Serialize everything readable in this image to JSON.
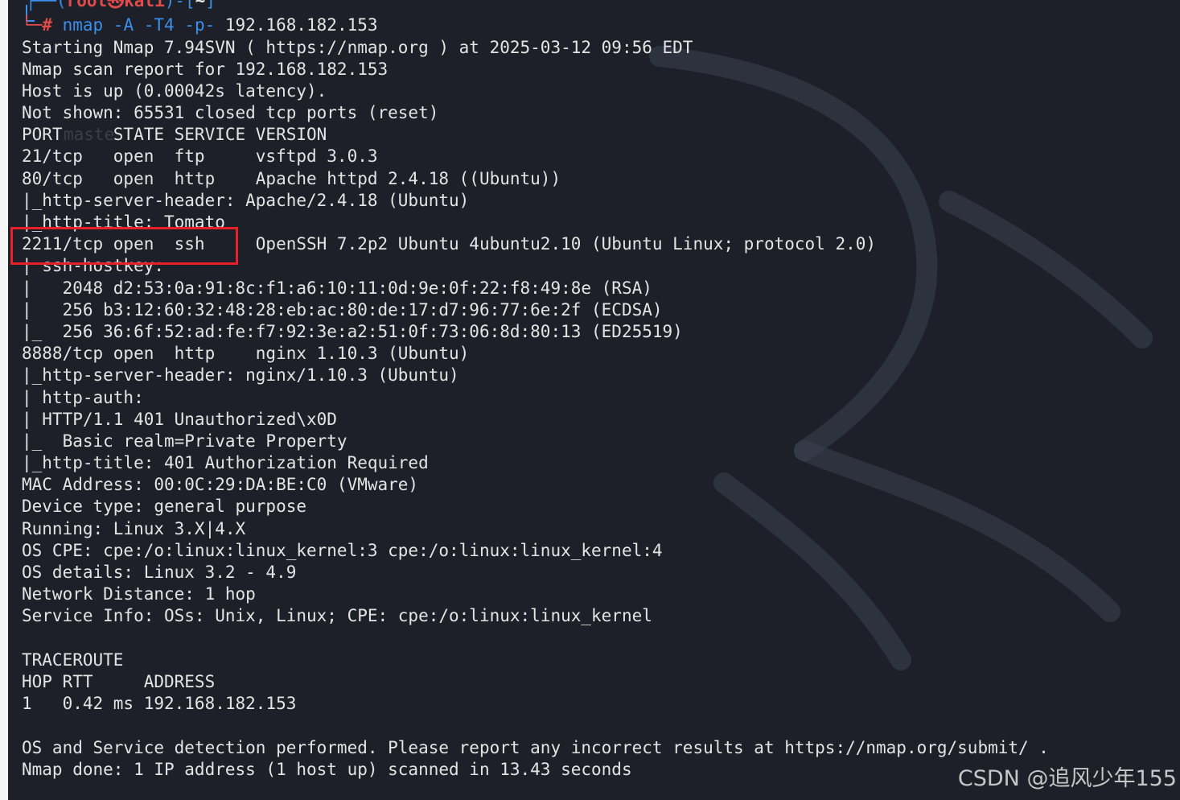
{
  "prompt": {
    "open": "┌──(",
    "user": "root㉿kali",
    "mid": ")-[",
    "cwd": "~",
    "close": "]",
    "hash": "└─#",
    "command": " nmap -A -T4 -p- ",
    "target": "192.168.182.153"
  },
  "output_lines": [
    "Starting Nmap 7.94SVN ( https://nmap.org ) at 2025-03-12 09:56 EDT",
    "Nmap scan report for 192.168.182.153",
    "Host is up (0.00042s latency).",
    "Not shown: 65531 closed tcp ports (reset)",
    "PORT     STATE SERVICE VERSION",
    "21/tcp   open  ftp     vsftpd 3.0.3",
    "80/tcp   open  http    Apache httpd 2.4.18 ((Ubuntu))",
    "|_http-server-header: Apache/2.4.18 (Ubuntu)",
    "|_http-title: Tomato",
    "2211/tcp open  ssh     OpenSSH 7.2p2 Ubuntu 4ubuntu2.10 (Ubuntu Linux; protocol 2.0)",
    "| ssh-hostkey: ",
    "|   2048 d2:53:0a:91:8c:f1:a6:10:11:0d:9e:0f:22:f8:49:8e (RSA)",
    "|   256 b3:12:60:32:48:28:eb:ac:80:de:17:d7:96:77:6e:2f (ECDSA)",
    "|_  256 36:6f:52:ad:fe:f7:92:3e:a2:51:0f:73:06:8d:80:13 (ED25519)",
    "8888/tcp open  http    nginx 1.10.3 (Ubuntu)",
    "|_http-server-header: nginx/1.10.3 (Ubuntu)",
    "| http-auth: ",
    "| HTTP/1.1 401 Unauthorized\\x0D",
    "|_  Basic realm=Private Property",
    "|_http-title: 401 Authorization Required",
    "MAC Address: 00:0C:29:DA:BE:C0 (VMware)",
    "Device type: general purpose",
    "Running: Linux 3.X|4.X",
    "OS CPE: cpe:/o:linux:linux_kernel:3 cpe:/o:linux:linux_kernel:4",
    "OS details: Linux 3.2 - 4.9",
    "Network Distance: 1 hop",
    "Service Info: OSs: Unix, Linux; CPE: cpe:/o:linux:linux_kernel",
    "",
    "TRACEROUTE",
    "HOP RTT     ADDRESS",
    "1   0.42 ms 192.168.182.153",
    "",
    "OS and Service detection performed. Please report any incorrect results at https://nmap.org/submit/ .",
    "Nmap done: 1 IP address (1 host up) scanned in 13.43 seconds"
  ],
  "ghost_text": "maste",
  "watermark": "CSDN @追风少年155",
  "colors": {
    "background": "#1d2028",
    "text": "#e4e4e4",
    "prompt_user": "#e14b4b",
    "prompt_frame": "#3b8eea",
    "highlight_box": "#e8202a"
  }
}
